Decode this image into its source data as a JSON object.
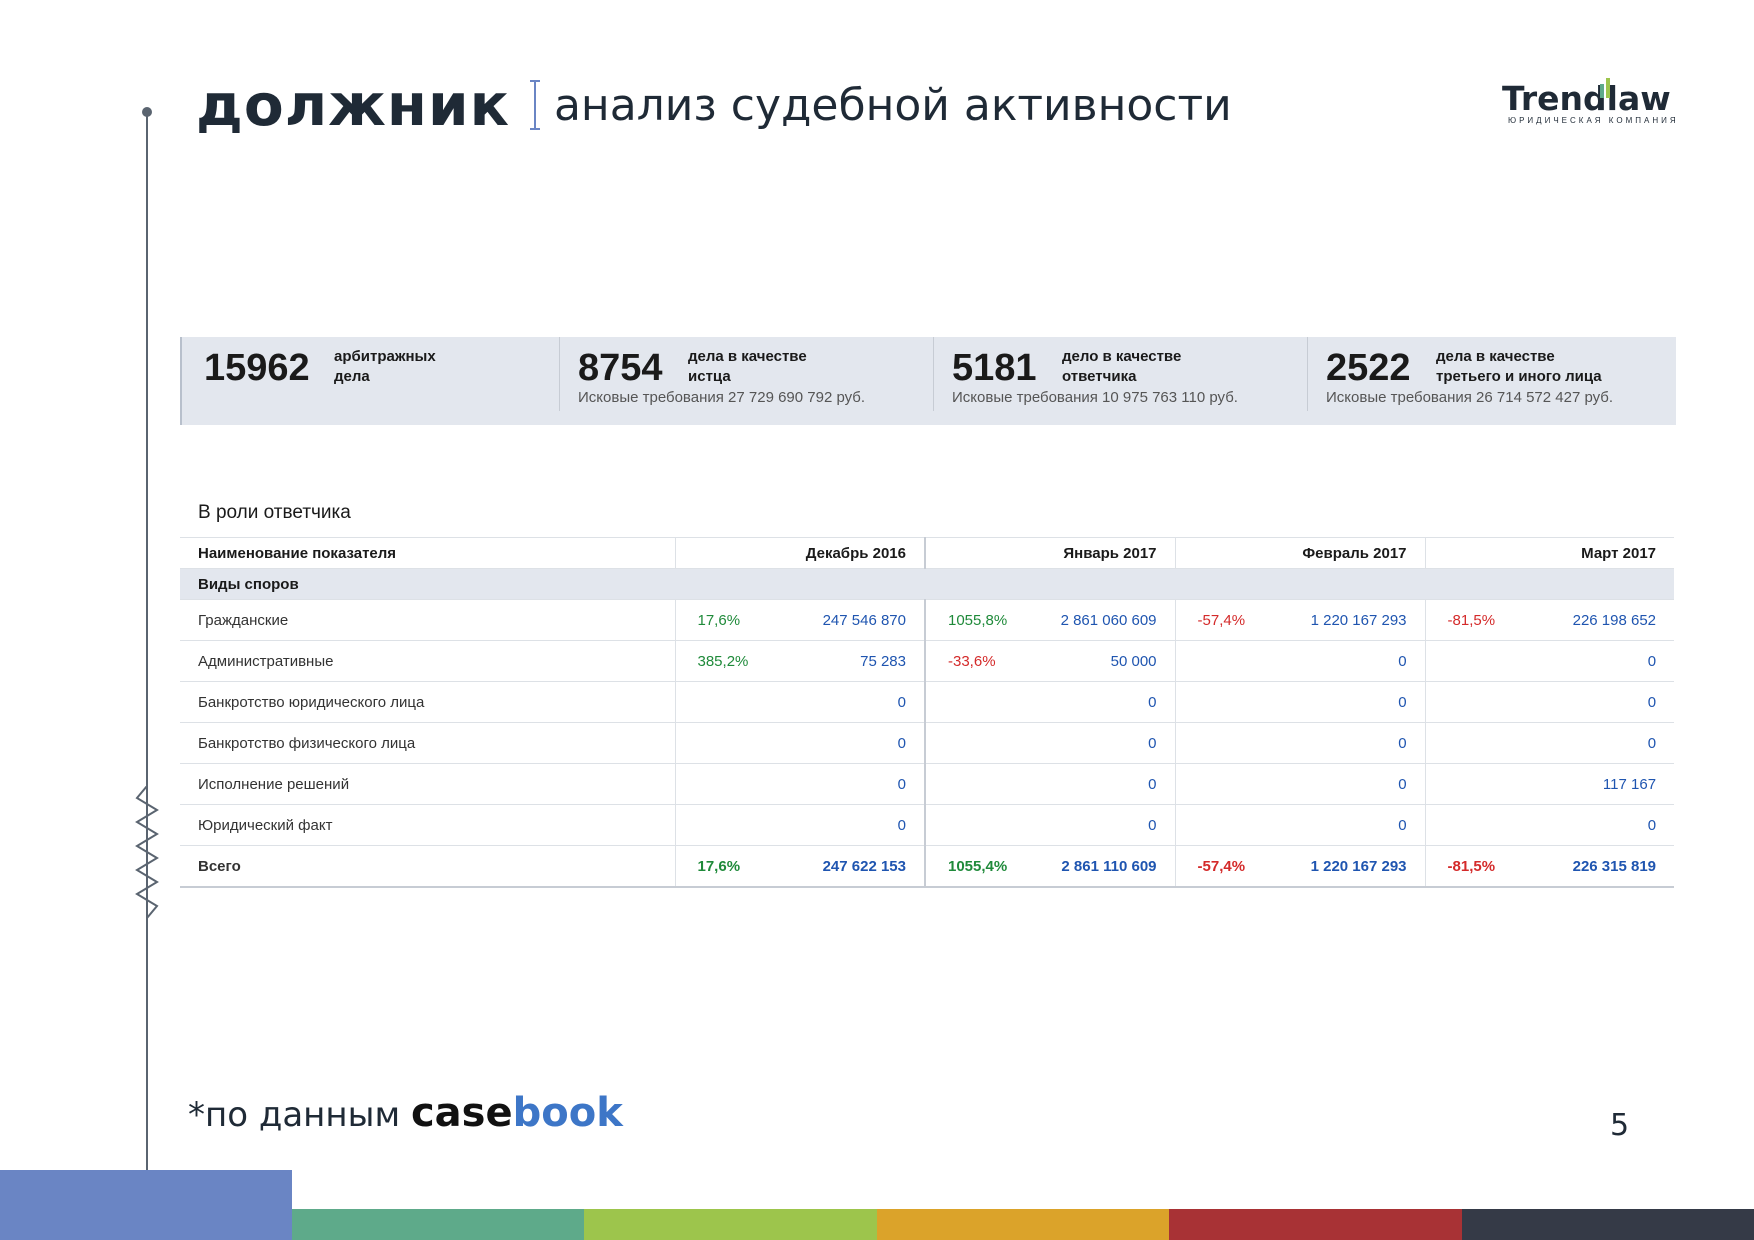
{
  "header": {
    "title_main": "должник",
    "title_sub": "анализ судебной активности"
  },
  "logo": {
    "name": "Trendlaw",
    "subtitle": "ЮРИДИЧЕСКАЯ КОМПАНИЯ"
  },
  "stats": [
    {
      "number": "15962",
      "label": "арбитражных\nдела",
      "claim": ""
    },
    {
      "number": "8754",
      "label": "дела в качестве\nистца",
      "claim": "Исковые требования 27 729 690 792 руб."
    },
    {
      "number": "5181",
      "label": "дело в качестве\nответчика",
      "claim": "Исковые требования 10 975 763 110 руб."
    },
    {
      "number": "2522",
      "label": "дела в качестве\nтретьего и иного лица",
      "claim": "Исковые требования 26 714 572 427 руб."
    }
  ],
  "section": {
    "title": "В роли ответчика"
  },
  "table": {
    "headers": [
      "Наименование показателя",
      "Декабрь 2016",
      "Январь 2017",
      "Февраль 2017",
      "Март 2017"
    ],
    "group": "Виды споров",
    "rows": [
      {
        "name": "Гражданские",
        "cells": [
          [
            "17,6%",
            "247 546 870"
          ],
          [
            "1055,8%",
            "2 861 060 609"
          ],
          [
            "-57,4%",
            "1 220 167 293"
          ],
          [
            "-81,5%",
            "226 198 652"
          ]
        ]
      },
      {
        "name": "Административные",
        "cells": [
          [
            "385,2%",
            "75 283"
          ],
          [
            "-33,6%",
            "50 000"
          ],
          [
            "",
            "0"
          ],
          [
            "",
            "0"
          ]
        ]
      },
      {
        "name": "Банкротство юридического лица",
        "cells": [
          [
            "",
            "0"
          ],
          [
            "",
            "0"
          ],
          [
            "",
            "0"
          ],
          [
            "",
            "0"
          ]
        ]
      },
      {
        "name": "Банкротство физического лица",
        "cells": [
          [
            "",
            "0"
          ],
          [
            "",
            "0"
          ],
          [
            "",
            "0"
          ],
          [
            "",
            "0"
          ]
        ]
      },
      {
        "name": "Исполнение решений",
        "cells": [
          [
            "",
            "0"
          ],
          [
            "",
            "0"
          ],
          [
            "",
            "0"
          ],
          [
            "",
            "117 167"
          ]
        ]
      },
      {
        "name": "Юридический факт",
        "cells": [
          [
            "",
            "0"
          ],
          [
            "",
            "0"
          ],
          [
            "",
            "0"
          ],
          [
            "",
            "0"
          ]
        ]
      },
      {
        "name": "Всего",
        "cells": [
          [
            "17,6%",
            "247 622 153"
          ],
          [
            "1055,4%",
            "2 861 110 609"
          ],
          [
            "-57,4%",
            "1 220 167 293"
          ],
          [
            "-81,5%",
            "226 315 819"
          ]
        ]
      }
    ]
  },
  "footnote": {
    "prefix": "*по данным ",
    "brand_a": "case",
    "brand_b": "book"
  },
  "page_number": "5",
  "colors": {
    "positive": "#1f8a3a",
    "negative": "#d42a2a",
    "value": "#1f55b0",
    "bars": [
      "#6a85c4",
      "#5eaa8a",
      "#9dc54c",
      "#dba32a",
      "#a83235",
      "#353a47"
    ]
  }
}
